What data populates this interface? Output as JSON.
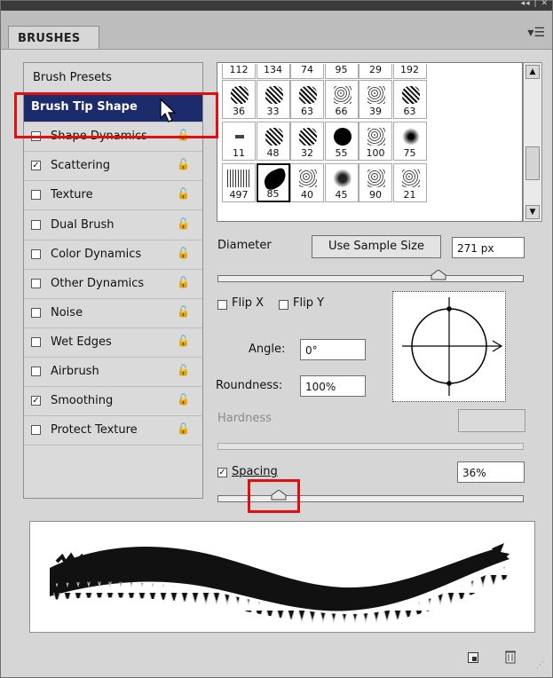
{
  "panel": {
    "title_controls": "◂◂ | ✕",
    "tab_label": "BRUSHES",
    "menu_icon": "panel-menu-icon"
  },
  "sidebar": {
    "items": [
      {
        "label": "Brush Presets",
        "checkbox": null,
        "lock": false
      },
      {
        "label": "Brush Tip Shape",
        "checkbox": null,
        "lock": false,
        "selected": true
      },
      {
        "label": "Shape Dynamics",
        "checkbox": false,
        "lock": true
      },
      {
        "label": "Scattering",
        "checkbox": true,
        "lock": true
      },
      {
        "label": "Texture",
        "checkbox": false,
        "lock": true
      },
      {
        "label": "Dual Brush",
        "checkbox": false,
        "lock": true
      },
      {
        "label": "Color Dynamics",
        "checkbox": false,
        "lock": true
      },
      {
        "label": "Other Dynamics",
        "checkbox": false,
        "lock": true
      },
      {
        "label": "Noise",
        "checkbox": false,
        "lock": true
      },
      {
        "label": "Wet Edges",
        "checkbox": false,
        "lock": true
      },
      {
        "label": "Airbrush",
        "checkbox": false,
        "lock": true
      },
      {
        "label": "Smoothing",
        "checkbox": true,
        "lock": true
      },
      {
        "label": "Protect Texture",
        "checkbox": false,
        "lock": true
      }
    ]
  },
  "brush_grid": {
    "top_row_numbers": [
      "112",
      "134",
      "74",
      "95",
      "29",
      "192"
    ],
    "rows": [
      [
        "36",
        "33",
        "63",
        "66",
        "39",
        "63"
      ],
      [
        "11",
        "48",
        "32",
        "55",
        "100",
        "75"
      ],
      [
        "497",
        "85",
        "40",
        "45",
        "90",
        "21"
      ]
    ],
    "selected": "85"
  },
  "controls": {
    "diameter_label": "Diameter",
    "use_sample_size": "Use Sample Size",
    "diameter_value": "271 px",
    "diameter_level": 0.73,
    "flip_x": "Flip X",
    "flip_y": "Flip Y",
    "angle_label": "Angle:",
    "angle_value": "0°",
    "roundness_label": "Roundness:",
    "roundness_value": "100%",
    "hardness_label": "Hardness",
    "hardness_value": "",
    "spacing_label": "Spacing",
    "spacing_checked": true,
    "spacing_value": "36%",
    "spacing_level": 0.18
  },
  "bottom": {
    "new_icon": "new-preset-icon",
    "trash_icon": "trash-icon"
  },
  "colors": {
    "selection_bg": "#1b2b6b",
    "highlight": "#e01010",
    "panel_bg": "#d6d6d6"
  }
}
